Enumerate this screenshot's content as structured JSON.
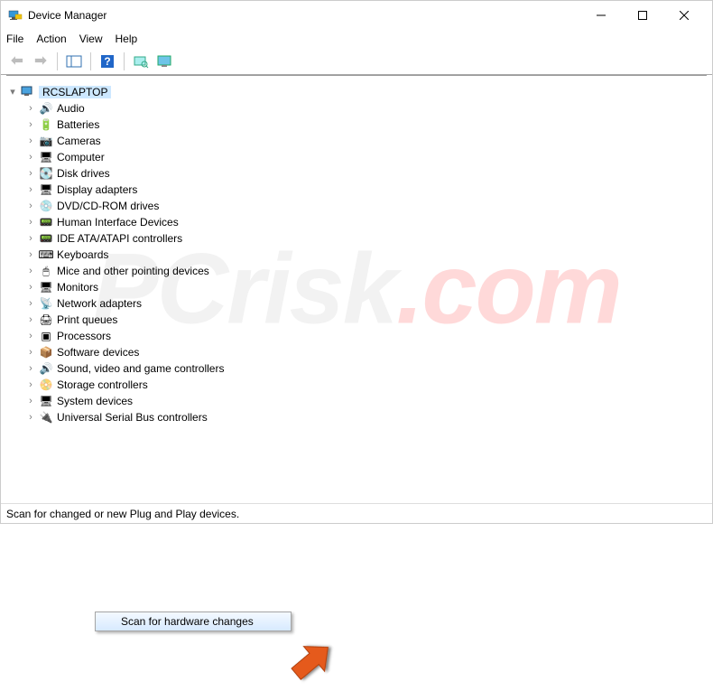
{
  "window": {
    "title": "Device Manager"
  },
  "menu": {
    "file": "File",
    "action": "Action",
    "view": "View",
    "help": "Help"
  },
  "tree": {
    "root": "RCSLAPTOP",
    "items": [
      {
        "label": "Audio",
        "icon": "🔊"
      },
      {
        "label": "Batteries",
        "icon": "🔋"
      },
      {
        "label": "Cameras",
        "icon": "📷"
      },
      {
        "label": "Computer",
        "icon": "🖥"
      },
      {
        "label": "Disk drives",
        "icon": "💽"
      },
      {
        "label": "Display adapters",
        "icon": "🖥"
      },
      {
        "label": "DVD/CD-ROM drives",
        "icon": "💿"
      },
      {
        "label": "Human Interface Devices",
        "icon": "📟"
      },
      {
        "label": "IDE ATA/ATAPI controllers",
        "icon": "📟"
      },
      {
        "label": "Keyboards",
        "icon": "⌨"
      },
      {
        "label": "Mice and other pointing devices",
        "icon": "🖱"
      },
      {
        "label": "Monitors",
        "icon": "🖥"
      },
      {
        "label": "Network adapters",
        "icon": "📡"
      },
      {
        "label": "Print queues",
        "icon": "🖨"
      },
      {
        "label": "Processors",
        "icon": "▣"
      },
      {
        "label": "Software devices",
        "icon": "📦"
      },
      {
        "label": "Sound, video and game controllers",
        "icon": "🔊"
      },
      {
        "label": "Storage controllers",
        "icon": "📀"
      },
      {
        "label": "System devices",
        "icon": "🖥"
      },
      {
        "label": "Universal Serial Bus controllers",
        "icon": "🔌"
      }
    ]
  },
  "context": {
    "scan": "Scan for hardware changes"
  },
  "status": {
    "text": "Scan for changed or new Plug and Play devices."
  },
  "colors": {
    "highlight": "#cde8ff",
    "arrow": "#e55a1b"
  }
}
